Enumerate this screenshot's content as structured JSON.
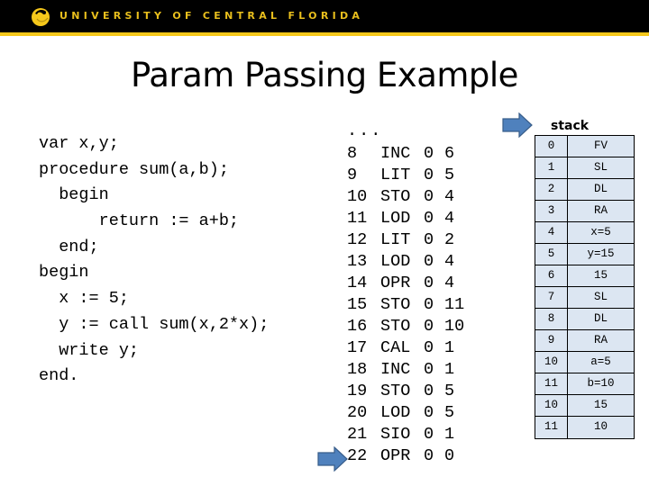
{
  "header": {
    "brand": "UNIVERSITY OF CENTRAL FLORIDA",
    "logo_icon": "ucf-pegasus-logo-icon",
    "colors": {
      "background": "#000000",
      "accent": "#f6c81b"
    }
  },
  "slide": {
    "title": "Param Passing Example"
  },
  "source_code": [
    "var x,y;",
    "procedure sum(a,b);",
    "  begin",
    "      return := a+b;",
    "  end;",
    "begin",
    "  x := 5;",
    "  y := call sum(x,2*x);",
    "  write y;",
    "end."
  ],
  "instructions": {
    "ellipsis": "...",
    "rows": [
      {
        "line": "8",
        "op": "INC",
        "l": "0",
        "m": "6"
      },
      {
        "line": "9",
        "op": "LIT",
        "l": "0",
        "m": "5"
      },
      {
        "line": "10",
        "op": "STO",
        "l": "0",
        "m": "4"
      },
      {
        "line": "11",
        "op": "LOD",
        "l": "0",
        "m": "4"
      },
      {
        "line": "12",
        "op": "LIT",
        "l": "0",
        "m": "2"
      },
      {
        "line": "13",
        "op": "LOD",
        "l": "0",
        "m": "4"
      },
      {
        "line": "14",
        "op": "OPR",
        "l": "0",
        "m": "4"
      },
      {
        "line": "15",
        "op": "STO",
        "l": "0",
        "m": "11"
      },
      {
        "line": "16",
        "op": "STO",
        "l": "0",
        "m": "10"
      },
      {
        "line": "17",
        "op": "CAL",
        "l": "0",
        "m": "1"
      },
      {
        "line": "18",
        "op": "INC",
        "l": "0",
        "m": "1"
      },
      {
        "line": "19",
        "op": "STO",
        "l": "0",
        "m": "5"
      },
      {
        "line": "20",
        "op": "LOD",
        "l": "0",
        "m": "5"
      },
      {
        "line": "21",
        "op": "SIO",
        "l": "0",
        "m": "1"
      },
      {
        "line": "22",
        "op": "OPR",
        "l": "0",
        "m": "0"
      }
    ],
    "pc_pointer": {
      "icon": "right-arrow-icon",
      "points_to_line": "22",
      "color": "#4f81bd"
    }
  },
  "stack": {
    "label": "stack",
    "top_pointer": {
      "icon": "right-arrow-icon",
      "points_to_index": "0",
      "color": "#4f81bd"
    },
    "cell_color": "#dce6f2",
    "rows": [
      {
        "index": "0",
        "value": "FV"
      },
      {
        "index": "1",
        "value": "SL"
      },
      {
        "index": "2",
        "value": "DL"
      },
      {
        "index": "3",
        "value": "RA"
      },
      {
        "index": "4",
        "value": "x=5"
      },
      {
        "index": "5",
        "value": "y=15"
      },
      {
        "index": "6",
        "value": "15"
      },
      {
        "index": "7",
        "value": "SL"
      },
      {
        "index": "8",
        "value": "DL"
      },
      {
        "index": "9",
        "value": "RA"
      },
      {
        "index": "10",
        "value": "a=5"
      },
      {
        "index": "11",
        "value": "b=10"
      },
      {
        "index": "10",
        "value": "15"
      },
      {
        "index": "11",
        "value": "10"
      }
    ]
  }
}
